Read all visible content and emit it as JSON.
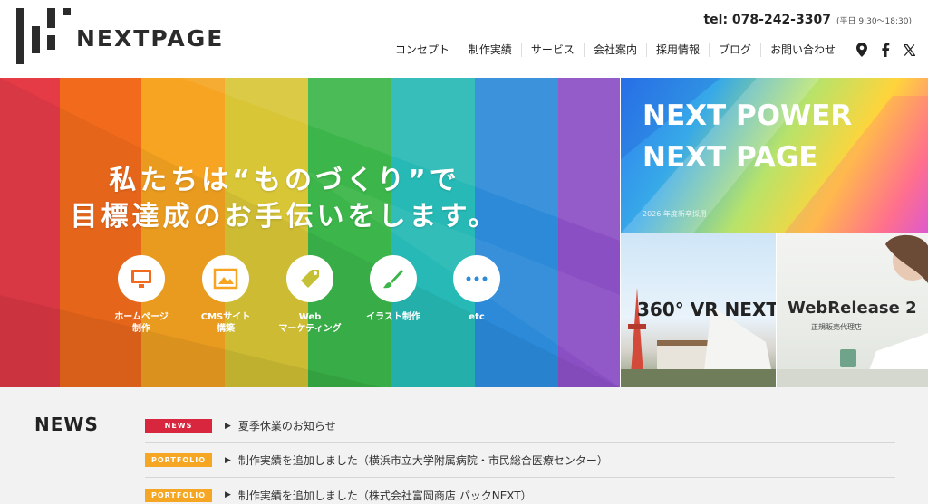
{
  "brand": {
    "name": "NEXTPAGE"
  },
  "header": {
    "tel": "tel: 078-242-3307",
    "hours": "(平日 9:30〜18:30)",
    "nav": [
      "コンセプト",
      "制作実績",
      "サービス",
      "会社案内",
      "採用情報",
      "ブログ",
      "お問い合わせ"
    ],
    "icons": [
      "map-pin-icon",
      "facebook-icon",
      "x-icon"
    ]
  },
  "hero": {
    "line1": "私たちは“ものづくり”で",
    "line2": "目標達成のお手伝いをします。",
    "services": [
      {
        "l1": "ホームページ",
        "l2": "制作",
        "icon": "monitor-icon"
      },
      {
        "l1": "CMSサイト",
        "l2": "構築",
        "icon": "image-window-icon"
      },
      {
        "l1": "Web",
        "l2": "マーケティング",
        "icon": "seo-tag-icon"
      },
      {
        "l1": "イラスト制作",
        "l2": "",
        "icon": "brush-icon"
      },
      {
        "l1": "etc",
        "l2": "",
        "icon": "more-dots-icon"
      }
    ]
  },
  "banners": {
    "recruit": {
      "line1": "NEXT POWER",
      "line2": "NEXT PAGE",
      "sub": "2026 年度新卒採用"
    },
    "vr": {
      "text": "360° VR NEXT"
    },
    "webrelease": {
      "title": "WebRelease 2",
      "sub": "正規販売代理店"
    }
  },
  "news": {
    "title": "NEWS",
    "items": [
      {
        "badge": "NEWS",
        "color": "#d7263d",
        "text": "夏季休業のお知らせ"
      },
      {
        "badge": "PORTFOLIO",
        "color": "#f5a623",
        "text": "制作実績を追加しました（横浜市立大学附属病院・市民総合医療センター）"
      },
      {
        "badge": "PORTFOLIO",
        "color": "#f5a623",
        "text": "制作実績を追加しました（株式会社富岡商店 パックNEXT）"
      }
    ]
  }
}
